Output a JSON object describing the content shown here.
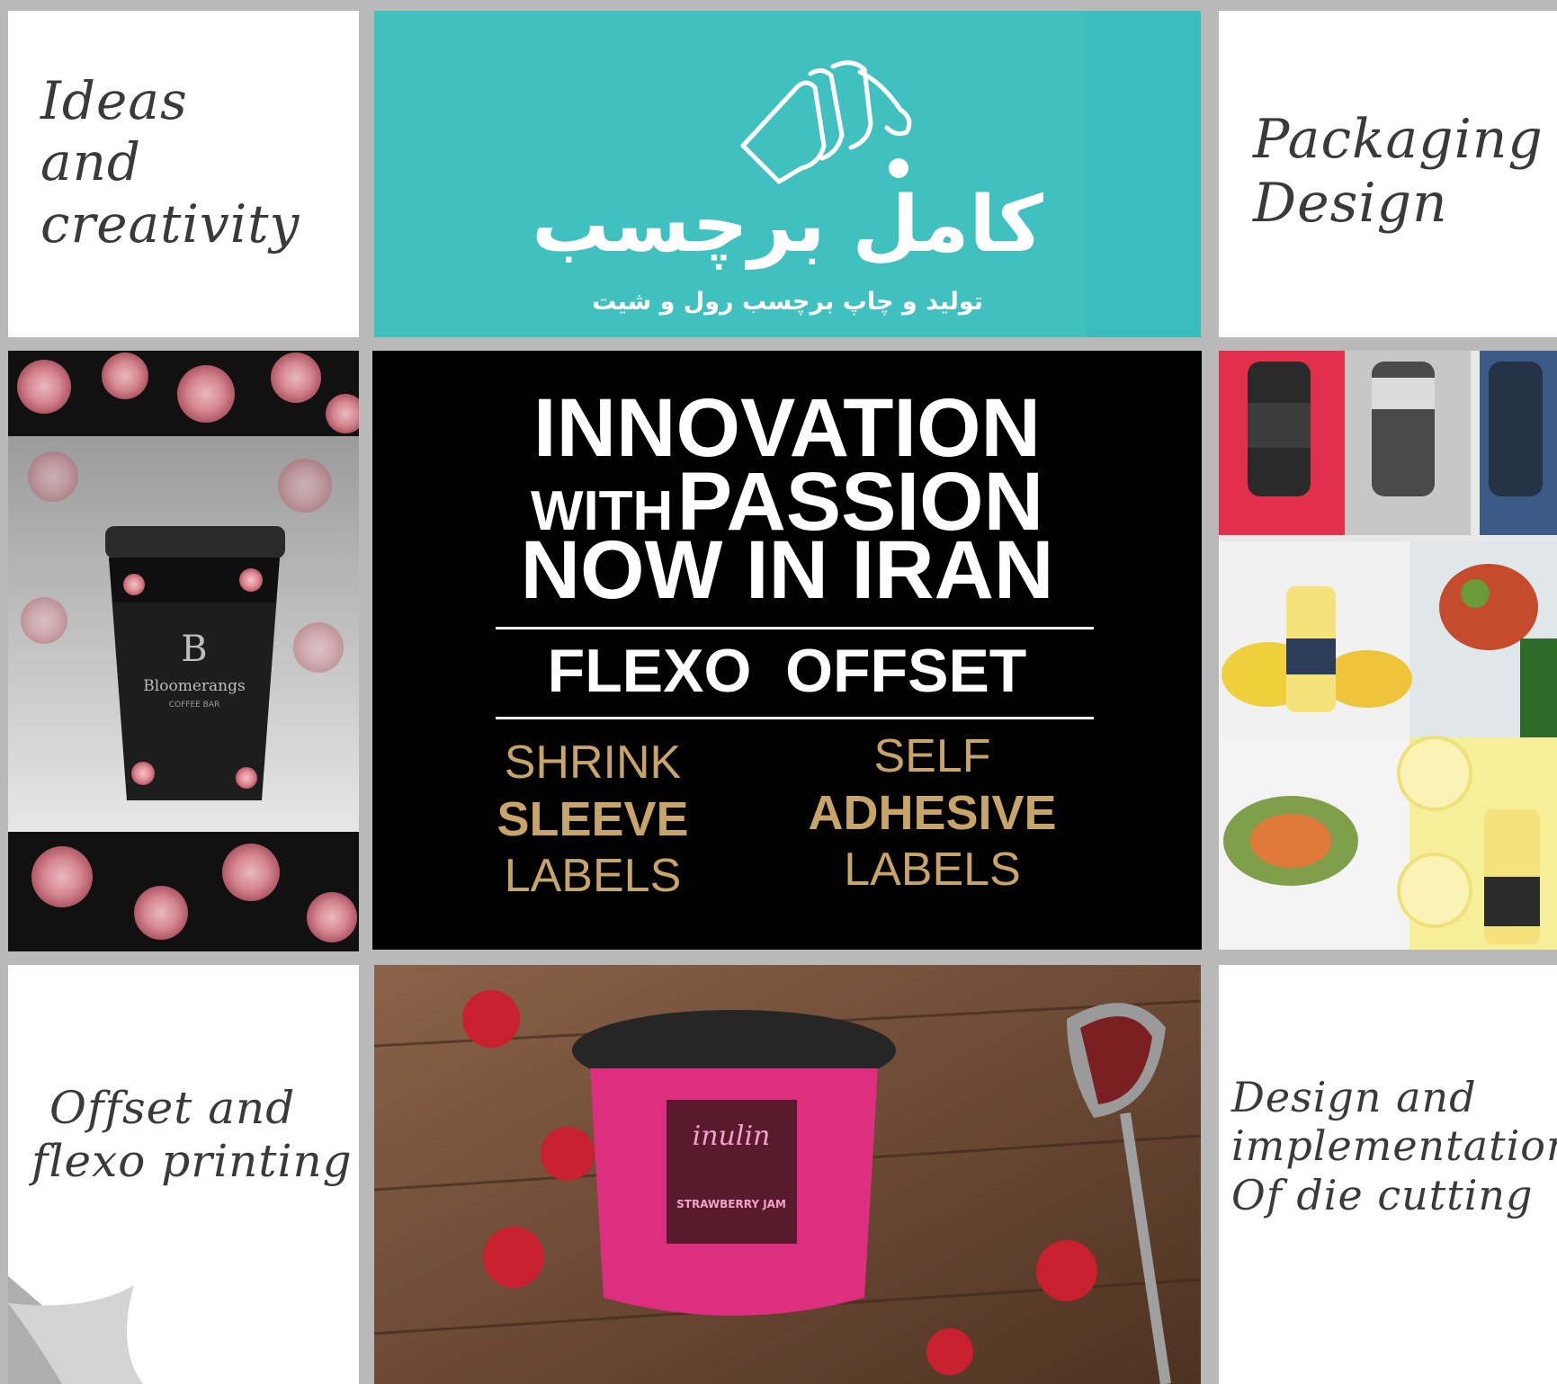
{
  "tiles": {
    "ideas": {
      "lines": [
        "Ideas",
        "and",
        "creativity"
      ]
    },
    "packaging": {
      "lines": [
        "Packaging",
        "Design"
      ]
    },
    "offset": {
      "lines": [
        "Offset and",
        "flexo printing"
      ]
    },
    "die_cutting": {
      "lines": [
        "Design and",
        "implementation",
        "Of die cutting"
      ]
    }
  },
  "logo": {
    "brand_name": "کامل برچسب",
    "tagline": "تولید و چاپ برچسب رول و شیت",
    "icon": "label-roll-icon"
  },
  "headline": {
    "line1": "INNOVATION",
    "line2_small": "WITH",
    "line2_big": "PASSION",
    "line3": "NOW IN IRAN",
    "methods": "FLEXO  OFFSET"
  },
  "products": {
    "left": [
      "SHRINK",
      "SLEEVE",
      "LABELS"
    ],
    "right": [
      "SELF",
      "ADHESIVE",
      "LABELS"
    ]
  },
  "images": {
    "cup": {
      "brand": "Bloomerangs",
      "sub": "COFFEE BAR"
    },
    "jar": {
      "brand": "inulin",
      "label": "STRAWBERRY JAM"
    }
  },
  "colors": {
    "teal": "#41c0c0",
    "gold": "#c8a468",
    "background": "#b9b9b9"
  }
}
